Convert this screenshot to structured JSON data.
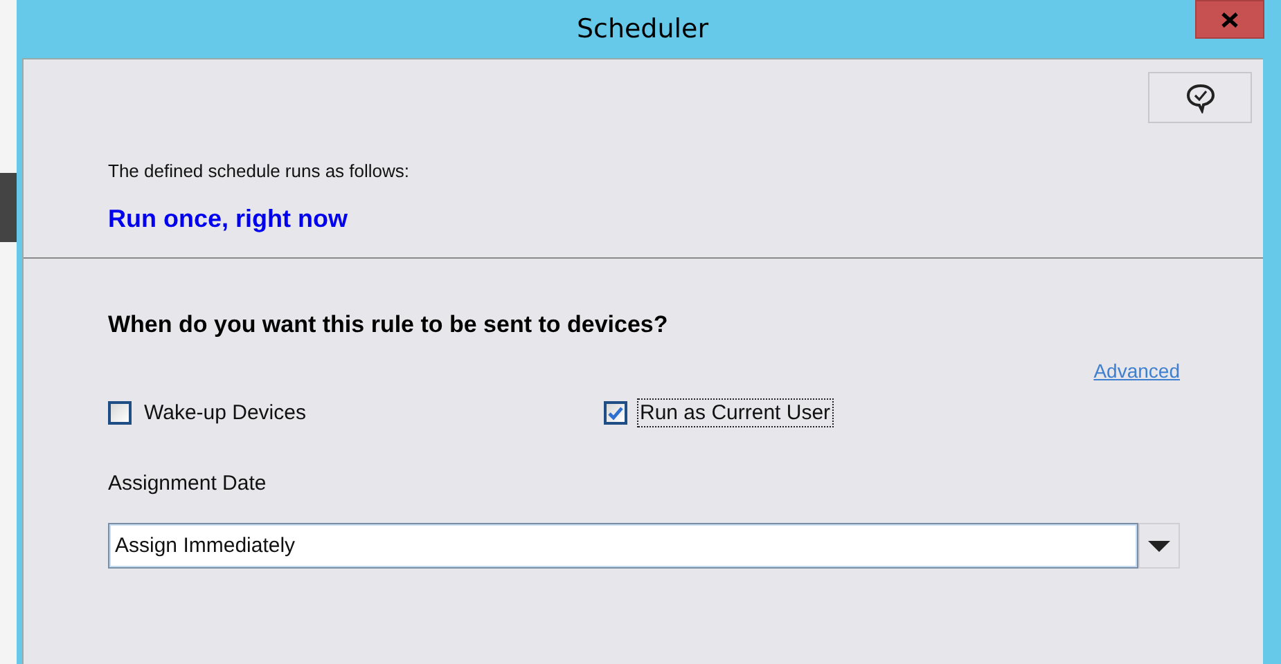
{
  "window": {
    "title": "Scheduler"
  },
  "summary": {
    "intro": "The defined schedule runs as follows:",
    "schedule": "Run once, right now"
  },
  "question": "When do you want this rule to be sent to devices?",
  "advanced_link": "Advanced",
  "options": [
    {
      "label": "Wake-up Devices",
      "checked": false,
      "focused": false
    },
    {
      "label": "Run as Current User",
      "checked": true,
      "focused": true
    }
  ],
  "assignment": {
    "label": "Assignment Date",
    "value": "Assign Immediately"
  }
}
